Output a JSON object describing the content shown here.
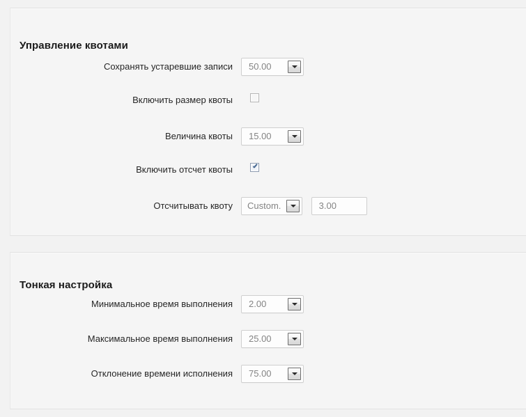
{
  "panels": [
    {
      "id": "quota",
      "title": "Управление квотами",
      "rows": [
        {
          "label": "Сохранять устаревшие записи",
          "type": "spinner",
          "value": "50.00"
        },
        {
          "label": "Включить размер квоты",
          "type": "checkbox",
          "checked": false
        },
        {
          "label": "Величина квоты",
          "type": "spinner",
          "value": "15.00"
        },
        {
          "label": "Включить отсчет квоты",
          "type": "checkbox",
          "checked": true
        },
        {
          "label": "Отсчитывать квоту",
          "type": "select-with-field",
          "select_value": "Custom.",
          "field_value": "3.00"
        }
      ]
    },
    {
      "id": "tuning",
      "title": "Тонкая настройка",
      "rows": [
        {
          "label": "Минимальное время выполнения",
          "type": "spinner",
          "value": "2.00"
        },
        {
          "label": "Максимальное время выполнения",
          "type": "spinner",
          "value": "25.00"
        },
        {
          "label": "Отклонение времени исполнения",
          "type": "spinner",
          "value": "75.00"
        }
      ]
    }
  ],
  "icons": {
    "dropdown_arrow": "chevron-down-icon",
    "check_mark": "check-icon"
  },
  "colors": {
    "page_background": "#f2f2f2",
    "panel_background": "#f5f5f5",
    "panel_border": "#e2e2e2",
    "label_text": "#262626",
    "value_text": "#848484",
    "checkbox_accent": "#4a6a93"
  }
}
